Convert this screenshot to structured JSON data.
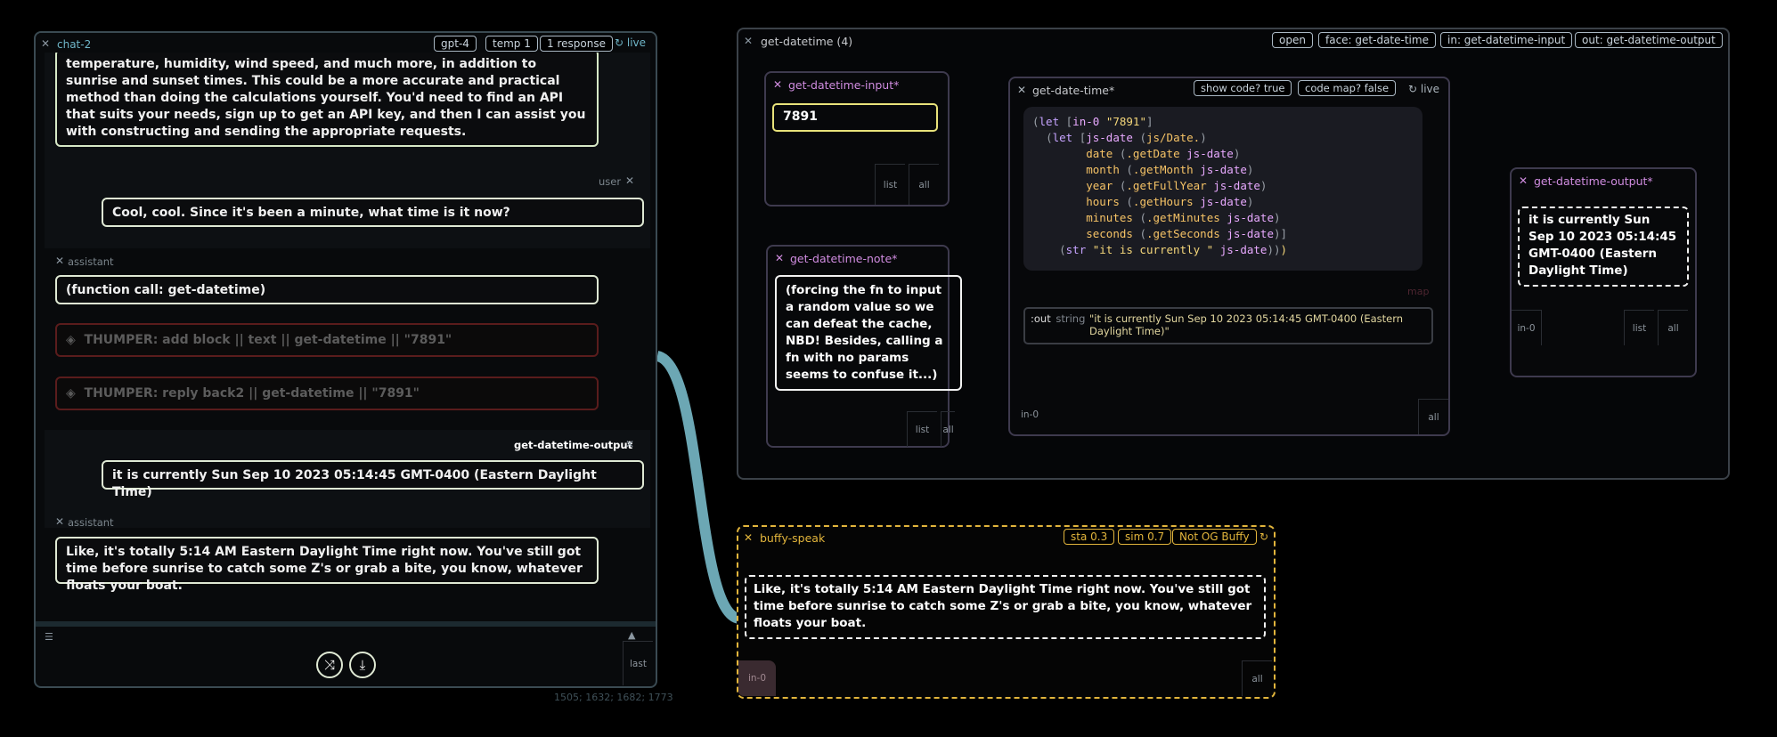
{
  "chat": {
    "title": "chat-2",
    "pills": [
      "gpt-4",
      "temp 1",
      "1 response",
      "live"
    ],
    "messages": {
      "first_text": "temperature, humidity, wind speed, and much more, in addition to sunrise and sunset times. This could be a more accurate and practical method than doing the calculations yourself. You'd need to find an API that suits your needs, sign up to get an API key, and then I can assist you with constructing and sending the appropriate requests.",
      "user_label": "user",
      "user_text": "Cool, cool. Since it's been a minute, what time is it now?",
      "assistant_label": "assistant",
      "call_text": "(function call: get-datetime)",
      "thumper1": "THUMPER: add block || text || get-datetime || \"7891\"",
      "thumper2": "THUMPER: reply back2 || get-datetime || \"7891\"",
      "output_label": "get-datetime-output",
      "output_text": "it is currently Sun Sep 10 2023 05:14:45 GMT-0400 (Eastern Daylight Time)",
      "assistant2_label": "assistant",
      "final_text": "Like, it's totally 5:14 AM Eastern Daylight Time right now. You've still got time before sunrise to catch some Z's or grab a bite, you know, whatever floats your boat."
    },
    "footer_last": "last",
    "coords": "1505; 1632; 1682; 1773"
  },
  "graph": {
    "title": "get-datetime (4)",
    "pills": [
      "open",
      "face: get-date-time",
      "in: get-datetime-input",
      "out: get-datetime-output"
    ],
    "input_node": {
      "title": "get-datetime-input*",
      "value": "7891",
      "btn_list": "list",
      "btn_all": "all"
    },
    "note_node": {
      "title": "get-datetime-note*",
      "text": "(forcing the fn to input a random value so we can defeat the cache, NBD! Besides, calling a fn with no params seems to confuse it...)",
      "btn_list": "list",
      "btn_all": "all"
    },
    "fn_node": {
      "title": "get-date-time*",
      "pills": [
        "show code? true",
        "code map? false",
        "live"
      ],
      "map_label": "map",
      "out_key": ":out",
      "out_type": "string",
      "out_value": "\"it is currently Sun Sep 10 2023 05:14:45 GMT-0400 (Eastern Daylight Time)\"",
      "in_label": "in-0",
      "btn_all": "all"
    },
    "output_node": {
      "title": "get-datetime-output*",
      "text": "it is currently Sun Sep 10 2023 05:14:45 GMT-0400 (Eastern Daylight Time)",
      "in_label": "in-0",
      "btn_list": "list",
      "btn_all": "all"
    }
  },
  "buffy": {
    "title": "buffy-speak",
    "pills": [
      "sta 0.3",
      "sim 0.7",
      "Not OG Buffy"
    ],
    "text": "Like, it's totally 5:14 AM Eastern Daylight Time right now. You've still got time before sunrise to catch some Z's or grab a bite, you know, whatever floats your boat.",
    "in_label": "in-0",
    "btn_all": "all"
  },
  "colors": {
    "accent_cyan": "#6fb6c9",
    "node_title": "#d08ce0",
    "buffy_gold": "#e2b53c",
    "input_yellow": "#e8e27a"
  }
}
